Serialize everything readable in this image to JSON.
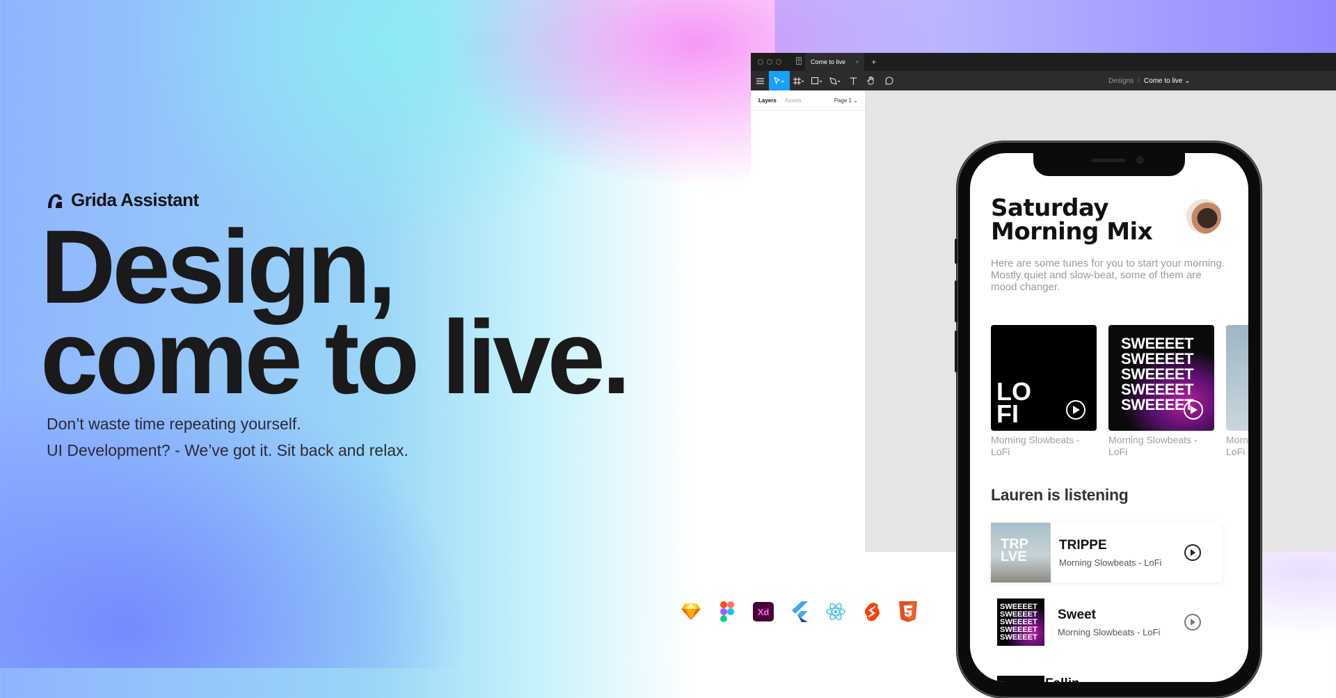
{
  "colors": {
    "accent": "#18a0fb",
    "text_dark": "#1a1a1a",
    "panel_dark": "#2c2c2c"
  },
  "brand": {
    "name": "Grida Assistant",
    "icon": "grida-logo-icon"
  },
  "hero": {
    "title_line1": "Design,",
    "title_line2": "come to live.",
    "sub_line1": "Don’t waste time repeating yourself.",
    "sub_line2": "UI Development? - We’ve got it. Sit back and relax."
  },
  "tools": [
    "sketch-icon",
    "figma-icon",
    "xd-icon",
    "flutter-icon",
    "react-icon",
    "svelte-icon",
    "html5-icon"
  ],
  "figma": {
    "tab_label": "Come to live",
    "tab_close": "×",
    "new_tab": "+",
    "breadcrumb_root": "Designs",
    "breadcrumb_sep": "/",
    "breadcrumb_file": "Come to live ⌄",
    "panel_tab_layers": "Layers",
    "panel_tab_assets": "Assets",
    "page_selector": "Page 1 ⌄"
  },
  "app": {
    "title_line1": "Saturday",
    "title_line2": "Morning Mix",
    "description": "Here are some tunes for you to start your morning. Mostly quiet and slow-beat, some of them are mood changer.",
    "cards": [
      {
        "cover_text": "LO FI",
        "label": "Morning Slowbeats - LoFi"
      },
      {
        "cover_text": "SWEEEET",
        "label": "Morning Slowbeats - LoFi"
      },
      {
        "cover_text": "",
        "label": "Morn LoFi"
      }
    ],
    "section_title": "Lauren is listening",
    "tracks": [
      {
        "title": "TRIPPE",
        "subtitle": "Morning Slowbeats - LoFi",
        "cover_text": "TRP LVE"
      },
      {
        "title": "Sweet",
        "subtitle": "Morning Slowbeats - LoFi",
        "cover_text": "SWEEEET"
      },
      {
        "title": "Fallin",
        "subtitle": "",
        "cover_text": ""
      }
    ]
  }
}
